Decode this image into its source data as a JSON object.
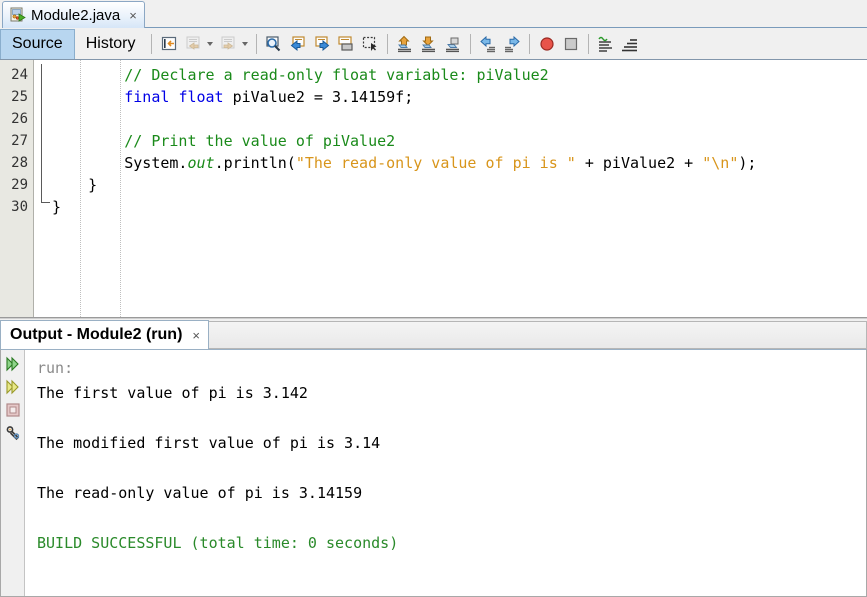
{
  "editor": {
    "document_tab": {
      "label": "Module2.java",
      "icon": "java-file-run-icon",
      "close_label": "×"
    },
    "view_tabs": [
      {
        "label": "Source",
        "selected": true
      },
      {
        "label": "History",
        "selected": false
      }
    ],
    "toolbar_groups": [
      {
        "buttons": [
          {
            "icon": "last-edit-position-icon",
            "enabled": true,
            "has_caret": false
          },
          {
            "icon": "back-navigation-icon",
            "enabled": false,
            "has_caret": true
          },
          {
            "icon": "forward-navigation-icon",
            "enabled": false,
            "has_caret": true
          }
        ]
      },
      {
        "buttons": [
          {
            "icon": "find-selection-icon",
            "enabled": true,
            "has_caret": false
          },
          {
            "icon": "find-previous-icon",
            "enabled": true,
            "has_caret": false
          },
          {
            "icon": "find-next-icon",
            "enabled": true,
            "has_caret": false
          },
          {
            "icon": "toggle-highlight-search-icon",
            "enabled": true,
            "has_caret": false
          },
          {
            "icon": "toggle-rectangular-selection-icon",
            "enabled": true,
            "has_caret": false
          }
        ]
      },
      {
        "buttons": [
          {
            "icon": "previous-bookmark-icon",
            "enabled": true,
            "has_caret": false
          },
          {
            "icon": "next-bookmark-icon",
            "enabled": true,
            "has_caret": false
          },
          {
            "icon": "toggle-bookmark-icon",
            "enabled": true,
            "has_caret": false
          }
        ]
      },
      {
        "buttons": [
          {
            "icon": "shift-left-icon",
            "enabled": true,
            "has_caret": false
          },
          {
            "icon": "shift-right-icon",
            "enabled": true,
            "has_caret": false
          }
        ]
      },
      {
        "buttons": [
          {
            "icon": "toggle-breakpoint-icon",
            "enabled": true,
            "has_caret": false
          },
          {
            "icon": "stop-icon",
            "enabled": true,
            "has_caret": false
          }
        ]
      },
      {
        "buttons": [
          {
            "icon": "toggle-comment-icon",
            "enabled": true,
            "has_caret": false
          },
          {
            "icon": "inspect-members-icon",
            "enabled": true,
            "has_caret": false
          }
        ]
      }
    ],
    "first_line_number": 24,
    "lines": [
      {
        "number": 24,
        "tokens": [
          {
            "text": "        ",
            "type": "plain"
          },
          {
            "text": "// Declare a read-only float variable: piValue2",
            "type": "comment"
          }
        ]
      },
      {
        "number": 25,
        "tokens": [
          {
            "text": "        ",
            "type": "plain"
          },
          {
            "text": "final",
            "type": "keyword"
          },
          {
            "text": " ",
            "type": "plain"
          },
          {
            "text": "float",
            "type": "keyword"
          },
          {
            "text": " piValue2 = 3.14159f;",
            "type": "plain"
          }
        ]
      },
      {
        "number": 26,
        "tokens": []
      },
      {
        "number": 27,
        "tokens": [
          {
            "text": "        ",
            "type": "plain"
          },
          {
            "text": "// Print the value of piValue2",
            "type": "comment"
          }
        ]
      },
      {
        "number": 28,
        "tokens": [
          {
            "text": "        ",
            "type": "plain"
          },
          {
            "text": "System.",
            "type": "plain"
          },
          {
            "text": "out",
            "type": "field"
          },
          {
            "text": ".println(",
            "type": "plain"
          },
          {
            "text": "\"The read-only value of pi is \"",
            "type": "string"
          },
          {
            "text": " + piValue2 + ",
            "type": "plain"
          },
          {
            "text": "\"\\n\"",
            "type": "string"
          },
          {
            "text": ");",
            "type": "plain"
          }
        ]
      },
      {
        "number": 29,
        "tokens": [
          {
            "text": "    }",
            "type": "plain"
          }
        ]
      },
      {
        "number": 30,
        "tokens": [
          {
            "text": "}",
            "type": "plain"
          }
        ]
      }
    ]
  },
  "output": {
    "tab": {
      "label": "Output - Module2 (run)",
      "close_label": "×"
    },
    "actions": [
      {
        "icon": "rerun-icon",
        "title": "Re-run"
      },
      {
        "icon": "rerun-alternate-icon",
        "title": "Re-run with different parameters"
      },
      {
        "icon": "stop-process-icon",
        "title": "Stop"
      },
      {
        "icon": "output-settings-icon",
        "title": "Settings"
      }
    ],
    "console_lines": [
      {
        "text": "run:",
        "style": "gray"
      },
      {
        "text": "The first value of pi is 3.142",
        "style": "normal"
      },
      {
        "text": "",
        "style": "blank"
      },
      {
        "text": "The modified first value of pi is 3.14",
        "style": "normal"
      },
      {
        "text": "",
        "style": "blank"
      },
      {
        "text": "The read-only value of pi is 3.14159",
        "style": "normal"
      },
      {
        "text": "",
        "style": "blank"
      },
      {
        "text": "BUILD SUCCESSFUL (total time: 0 seconds)",
        "style": "green"
      }
    ]
  },
  "colors": {
    "comment": "#1a8a1a",
    "keyword": "#0000e6",
    "string": "#d8951b",
    "field": "#1a8a1a",
    "success": "#2a8a2a",
    "tab_selected": "#b8d6f0"
  }
}
